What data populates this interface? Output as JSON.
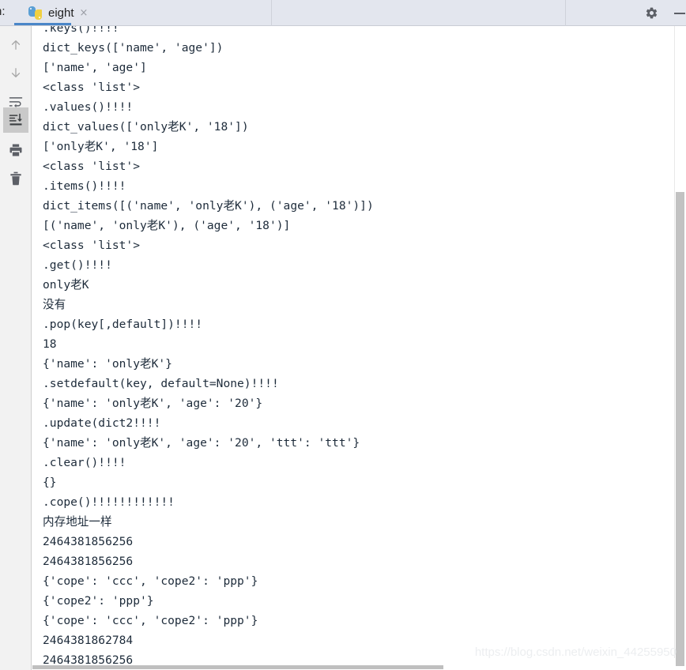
{
  "header": {
    "left_label": "n:",
    "tab": {
      "icon": "python-icon",
      "label": "eight",
      "close": "×"
    },
    "gear_icon": "gear-icon",
    "minimize_icon": "minimize-icon"
  },
  "toolbar": {
    "items": [
      {
        "name": "scroll-up-icon",
        "title": "Up the stack trace"
      },
      {
        "name": "scroll-down-icon",
        "title": "Down the stack trace"
      },
      {
        "name": "soft-wrap-icon",
        "title": "Soft-Wrap"
      },
      {
        "name": "scroll-to-end-icon",
        "title": "Scroll to the end",
        "active": true
      },
      {
        "name": "print-icon",
        "title": "Print"
      },
      {
        "name": "trash-icon",
        "title": "Clear All"
      }
    ]
  },
  "console": {
    "lines": [
      ".keys()!!!!",
      "dict_keys(['name', 'age'])",
      "['name', 'age']",
      "<class 'list'>",
      ".values()!!!!",
      "dict_values(['only老K', '18'])",
      "['only老K', '18']",
      "<class 'list'>",
      ".items()!!!!",
      "dict_items([('name', 'only老K'), ('age', '18')])",
      "[('name', 'only老K'), ('age', '18')]",
      "<class 'list'>",
      ".get()!!!!",
      "only老K",
      "没有",
      ".pop(key[,default])!!!!",
      "18",
      "{'name': 'only老K'}",
      ".setdefault(key, default=None)!!!!",
      "{'name': 'only老K', 'age': '20'}",
      ".update(dict2!!!!",
      "{'name': 'only老K', 'age': '20', 'ttt': 'ttt'}",
      ".clear()!!!!",
      "{}",
      ".cope()!!!!!!!!!!!!",
      "内存地址一样",
      "2464381856256",
      "2464381856256",
      "{'cope': 'ccc', 'cope2': 'ppp'}",
      "{'cope2': 'ppp'}",
      "{'cope': 'ccc', 'cope2': 'ppp'}",
      "2464381862784",
      "2464381856256"
    ]
  },
  "scrollbars": {
    "vertical_name": "vertical-scrollbar",
    "horizontal_name": "horizontal-scrollbar"
  },
  "watermark": {
    "text": "https://blog.csdn.net/weixin_44255950"
  },
  "colors": {
    "header_bg": "#e3e6ee",
    "tab_accent": "#4a86c8",
    "console_text": "#1d2b3a",
    "toolbar_bg": "#f2f2f2"
  }
}
